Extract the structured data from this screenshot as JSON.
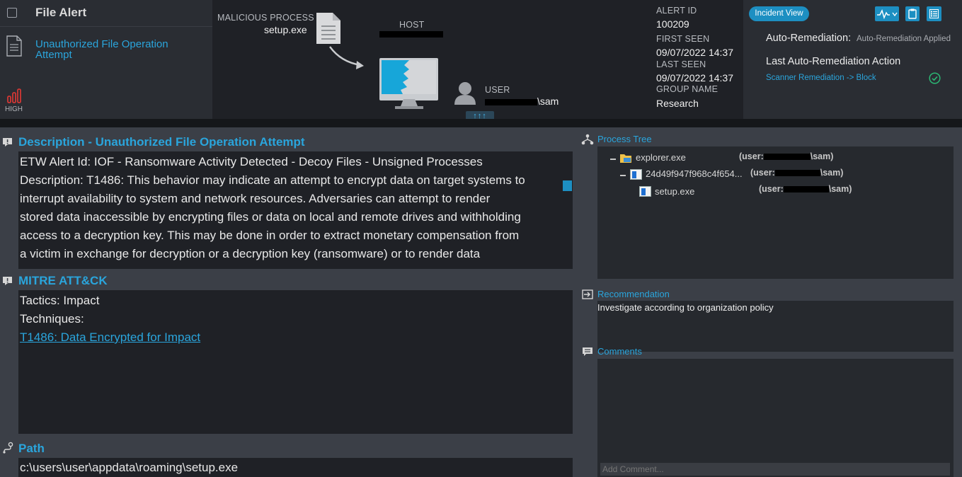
{
  "header": {
    "title": "File Alert",
    "alert_name": "Unauthorized File Operation Attempt",
    "severity": "HIGH"
  },
  "attack": {
    "malicious_process_label": "MALICIOUS PROCESS",
    "malicious_process": "setup.exe",
    "host_label": "HOST",
    "user_label": "USER",
    "user_value_suffix": "\\sam",
    "expand_arrows": "↑↑↑"
  },
  "alert_info": {
    "alert_id_label": "ALERT ID",
    "alert_id": "100209",
    "first_seen_label": "FIRST SEEN",
    "first_seen": "09/07/2022 14:37",
    "last_seen_label": "LAST SEEN",
    "last_seen": "09/07/2022 14:37",
    "group_name_label": "GROUP NAME",
    "group_name": "Research"
  },
  "toolbar": {
    "incident_view": "Incident View"
  },
  "remediation": {
    "auto_label": "Auto-Remediation:",
    "auto_value": "Auto-Remediation Applied",
    "last_label": "Last Auto-Remediation Action",
    "last_value": "Scanner Remediation -> Block"
  },
  "description": {
    "title": "Description - Unauthorized File Operation Attempt",
    "lines": [
      "ETW Alert Id: IOF - Ransomware Activity Detected - Decoy Files - Unsigned Processes",
      "Description: T1486: This behavior may indicate an attempt to encrypt data on target systems to",
      "interrupt availability to system and network resources. Adversaries can attempt to render",
      "stored data inaccessible by encrypting files or data on local and remote drives and withholding",
      "access to a decryption key. This may be done in order to extract monetary compensation from",
      "a victim in exchange for decryption or a decryption key (ransomware) or to render data"
    ]
  },
  "mitre": {
    "title": "MITRE ATT&CK",
    "tactics": "Tactics: Impact",
    "techniques": "Techniques:",
    "technique_link": "T1486: Data Encrypted for Impact"
  },
  "path": {
    "title": "Path",
    "value": "c:\\users\\user\\appdata\\roaming\\setup.exe"
  },
  "process_tree": {
    "title": "Process Tree",
    "nodes": [
      {
        "name": "explorer.exe",
        "user_prefix": "(user:",
        "user_suffix": "\\sam)"
      },
      {
        "name": "24d49f947f968c4f654...",
        "user_prefix": "(user:",
        "user_suffix": "\\sam)"
      },
      {
        "name": "setup.exe",
        "user_prefix": "(user:",
        "user_suffix": "\\sam)"
      }
    ]
  },
  "recommendation": {
    "title": "Recommendation",
    "text": "Investigate according to organization policy"
  },
  "comments": {
    "title": "Comments",
    "placeholder": "Add Comment..."
  },
  "colors": {
    "accent": "#2aa5dc",
    "success": "#2bb673",
    "severity_high": "#e53935"
  }
}
